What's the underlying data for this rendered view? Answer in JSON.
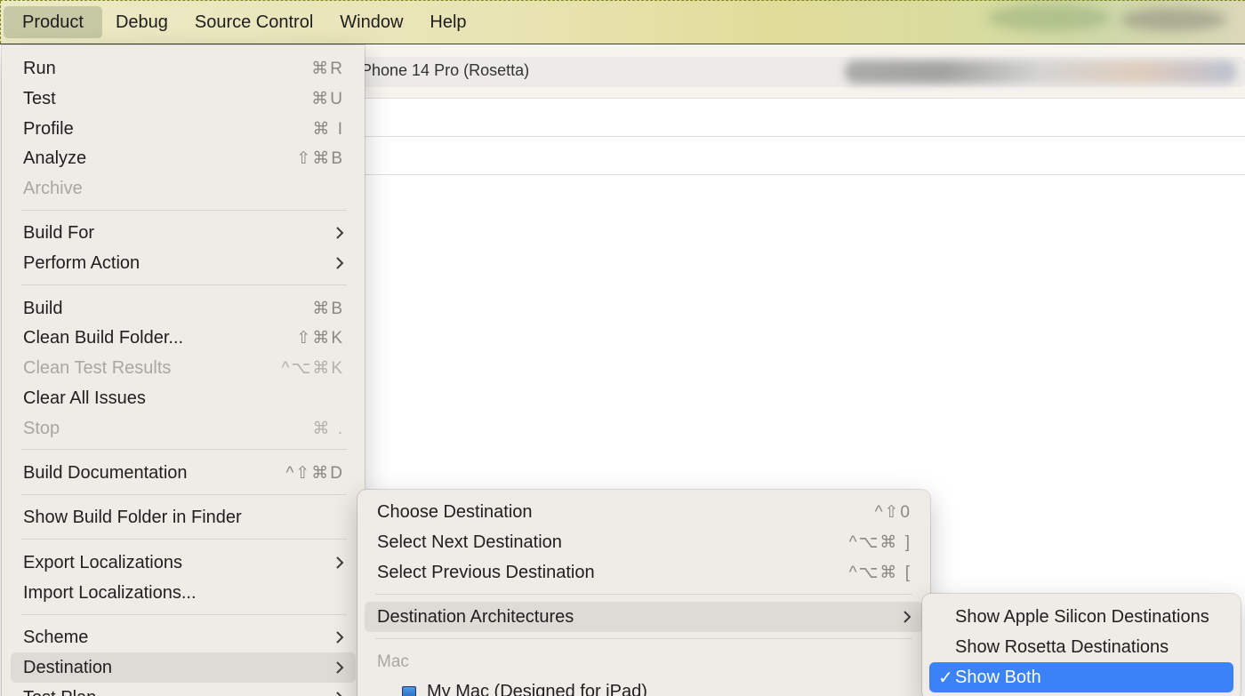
{
  "menubar": {
    "items": [
      "Product",
      "Debug",
      "Source Control",
      "Window",
      "Help"
    ]
  },
  "window": {
    "scheme_destination": "Phone 14 Pro (Rosetta)"
  },
  "product_menu": {
    "items": [
      {
        "label": "Run",
        "shortcut": "⌘R"
      },
      {
        "label": "Test",
        "shortcut": "⌘U"
      },
      {
        "label": "Profile",
        "shortcut": "⌘ I"
      },
      {
        "label": "Analyze",
        "shortcut": "⇧⌘B"
      },
      {
        "label": "Archive",
        "shortcut": ""
      },
      {
        "label": "Build For",
        "shortcut": ""
      },
      {
        "label": "Perform Action",
        "shortcut": ""
      },
      {
        "label": "Build",
        "shortcut": "⌘B"
      },
      {
        "label": "Clean Build Folder...",
        "shortcut": "⇧⌘K"
      },
      {
        "label": "Clean Test Results",
        "shortcut": "^⌥⌘K"
      },
      {
        "label": "Clear All Issues",
        "shortcut": ""
      },
      {
        "label": "Stop",
        "shortcut": "⌘ ."
      },
      {
        "label": "Build Documentation",
        "shortcut": "^⇧⌘D"
      },
      {
        "label": "Show Build Folder in Finder",
        "shortcut": ""
      },
      {
        "label": "Export Localizations",
        "shortcut": ""
      },
      {
        "label": "Import Localizations...",
        "shortcut": ""
      },
      {
        "label": "Scheme",
        "shortcut": ""
      },
      {
        "label": "Destination",
        "shortcut": ""
      },
      {
        "label": "Test Plan",
        "shortcut": ""
      }
    ]
  },
  "destination_menu": {
    "items": [
      {
        "label": "Choose Destination",
        "shortcut": "^⇧0"
      },
      {
        "label": "Select Next Destination",
        "shortcut": "^⌥⌘ ]"
      },
      {
        "label": "Select Previous Destination",
        "shortcut": "^⌥⌘ ["
      },
      {
        "label": "Destination Architectures",
        "shortcut": ""
      }
    ],
    "section_mac": "Mac",
    "device": "My Mac (Designed for iPad)"
  },
  "architectures_menu": {
    "items": [
      {
        "label": "Show Apple Silicon Destinations"
      },
      {
        "label": "Show Rosetta Destinations"
      },
      {
        "label": "Show Both"
      }
    ],
    "checkmark": "✓"
  },
  "colors": {
    "selection_blue": "#3b82f6",
    "menu_bg": "#efebe6",
    "disabled_text": "#a9a7a3"
  }
}
